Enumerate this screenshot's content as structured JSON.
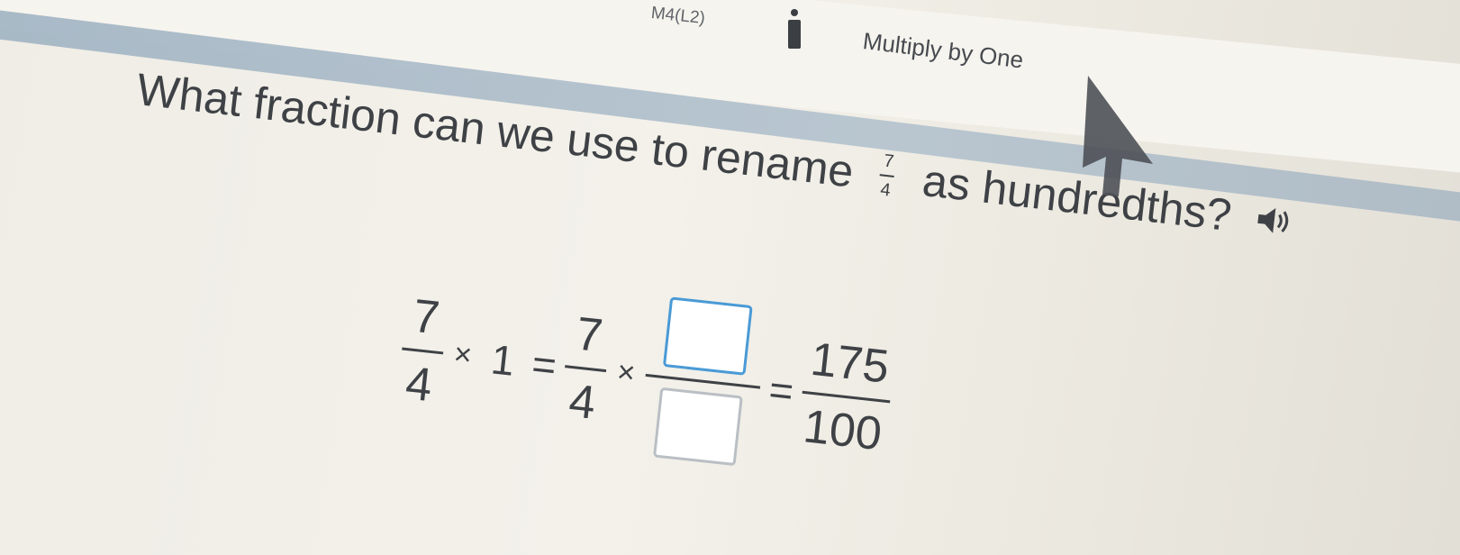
{
  "header": {
    "lesson_code": "M4(L2)",
    "lesson_title": "Multiply by One",
    "icon": "person-icon",
    "line_color": "#a9bac8"
  },
  "question": {
    "text_before": "What fraction can we use to rename",
    "fraction_numerator": "7",
    "fraction_denominator": "4",
    "text_after": "as hundredths?",
    "audio_icon": "speaker-icon"
  },
  "equation": {
    "left_numerator": "7",
    "left_denominator": "4",
    "times_symbol": "×",
    "one": "1",
    "equals_symbol": "=",
    "mid_numerator": "7",
    "mid_denominator": "4",
    "result_numerator": "175",
    "result_denominator": "100",
    "answer_numerator": "",
    "answer_denominator": ""
  },
  "colors": {
    "input_border": "#4a9ad6",
    "text": "#3e4145"
  }
}
